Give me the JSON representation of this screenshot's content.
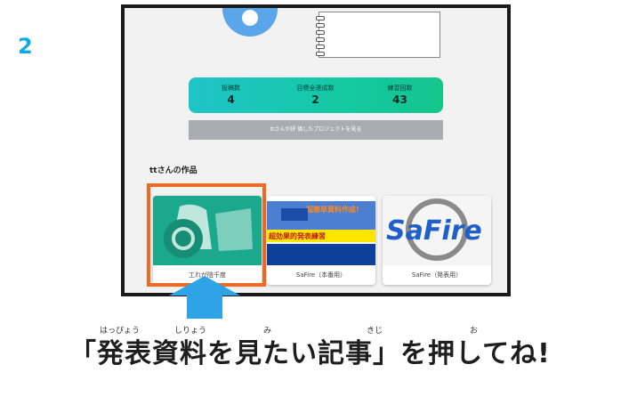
{
  "step": "2",
  "stats": {
    "posts": {
      "label": "投稿数",
      "value": "4"
    },
    "goals": {
      "label": "目標全達成数",
      "value": "2"
    },
    "practice": {
      "label": "練習回数",
      "value": "43"
    }
  },
  "view_eval_label": "ttさんが評 価したプロジェクトを見る",
  "works_title": "ttさんの作品",
  "cards": [
    {
      "caption": "工れが陰千度"
    },
    {
      "caption": "SaFire（本番用）",
      "thumb_text1": "超簡単資料作成!",
      "thumb_text2": "超効果的発表練習"
    },
    {
      "caption": "SaFire（発表用）",
      "logo": "SaFire"
    }
  ],
  "instruction": "「発表資料を見たい記事」を押してね!",
  "ruby": {
    "happyou": "はっぴょう",
    "shiryou": "しりょう",
    "mi": "み",
    "kiji": "きじ",
    "o": "お"
  },
  "colors": {
    "accent": "#12a9e8",
    "highlight": "#ef6a22",
    "arrow": "#2ea3e6"
  }
}
